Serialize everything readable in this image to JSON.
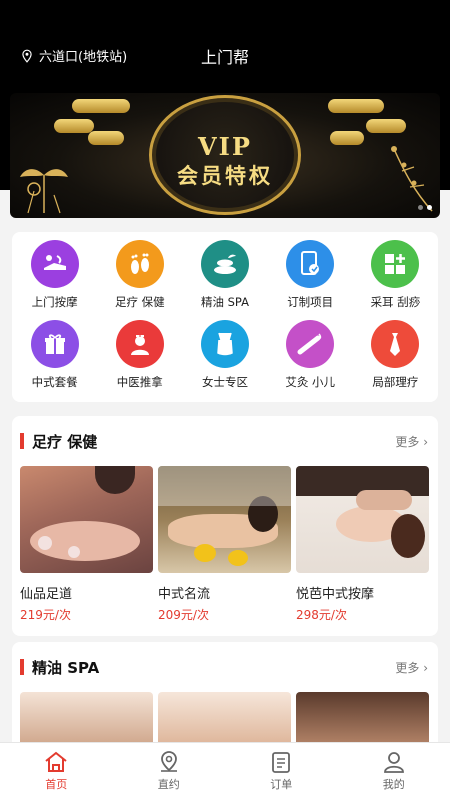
{
  "header": {
    "location": "六道口(地铁站)",
    "title": "上门帮"
  },
  "banner": {
    "line1": "VIP",
    "line2": "会员特权",
    "dots": 2,
    "active_dot": 1
  },
  "categories": [
    {
      "label": "上门按摩",
      "icon": "massage-icon",
      "color": "#9b3fe0"
    },
    {
      "label": "足疗 保健",
      "icon": "feet-icon",
      "color": "#f39a1c"
    },
    {
      "label": "精油 SPA",
      "icon": "spa-stones-icon",
      "color": "#1f8f86"
    },
    {
      "label": "订制项目",
      "icon": "phone-order-icon",
      "color": "#2d8fe8"
    },
    {
      "label": "采耳 刮痧",
      "icon": "grid-plus-icon",
      "color": "#4cc04b"
    },
    {
      "label": "中式套餐",
      "icon": "gift-icon",
      "color": "#8c4fe6"
    },
    {
      "label": "中医推拿",
      "icon": "doctor-icon",
      "color": "#ea3a3a"
    },
    {
      "label": "女士专区",
      "icon": "swimsuit-icon",
      "color": "#1aa3e0"
    },
    {
      "label": "艾灸 小儿",
      "icon": "moxa-stick-icon",
      "color": "#c450c8"
    },
    {
      "label": "局部理疗",
      "icon": "tie-icon",
      "color": "#ee4b3a"
    }
  ],
  "section1": {
    "title": "足疗 保健",
    "more": "更多",
    "items": [
      {
        "name": "仙品足道",
        "price": "219元/次"
      },
      {
        "name": "中式名流",
        "price": "209元/次"
      },
      {
        "name": "悦芭中式按摩",
        "price": "298元/次"
      }
    ]
  },
  "section2": {
    "title": "精油 SPA",
    "more": "更多"
  },
  "tabs": [
    {
      "label": "首页",
      "icon": "home-icon",
      "active": true
    },
    {
      "label": "直约",
      "icon": "map-pin-icon",
      "active": false
    },
    {
      "label": "订单",
      "icon": "order-list-icon",
      "active": false
    },
    {
      "label": "我的",
      "icon": "user-icon",
      "active": false
    }
  ],
  "colors": {
    "accent": "#e33b2f",
    "header_bg": "#000000",
    "gold": "#f6dc83"
  }
}
